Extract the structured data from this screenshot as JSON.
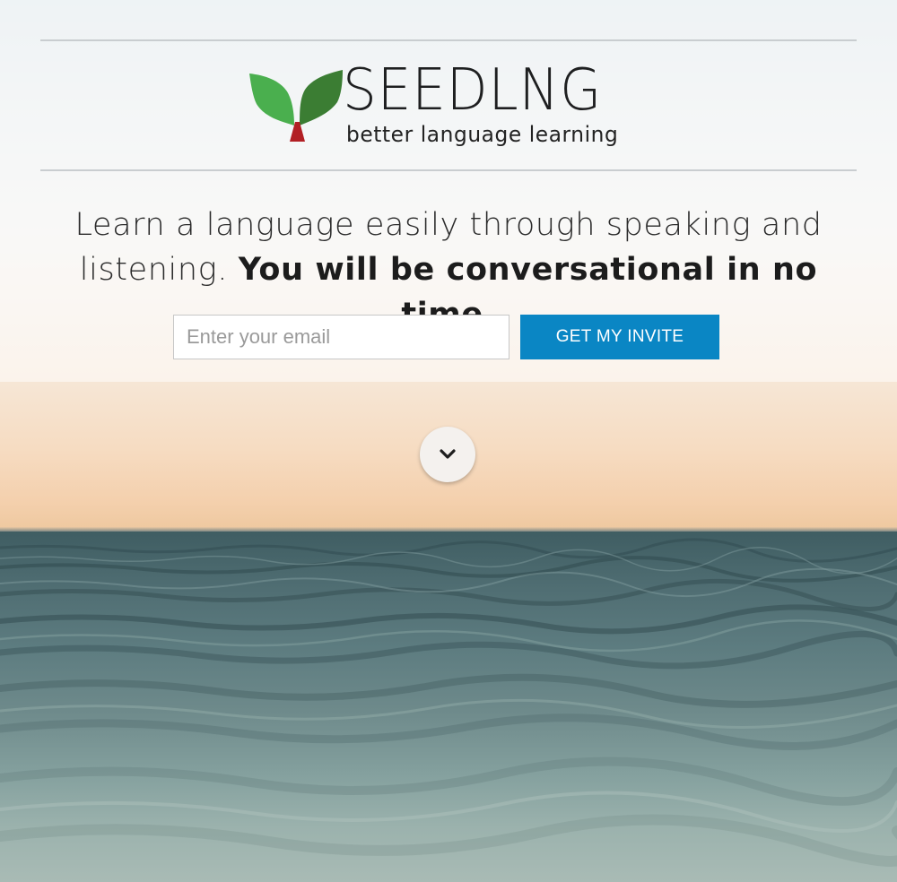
{
  "brand": {
    "name": "SEEDLNG",
    "tagline": "better language learning",
    "logo_icon": "sprout-icon",
    "colors": {
      "leaf_light": "#4aaf4e",
      "leaf_dark": "#3b7d33",
      "stem": "#b21f24"
    }
  },
  "hero": {
    "headline_regular": "Learn a language easily through speaking and listening. ",
    "headline_bold": "You will be conversational in no time."
  },
  "signup": {
    "email_placeholder": "Enter your email",
    "email_value": "",
    "button_label": "GET MY INVITE",
    "button_color": "#0a86c4"
  },
  "scroll_down": {
    "icon": "chevron-down-icon"
  }
}
